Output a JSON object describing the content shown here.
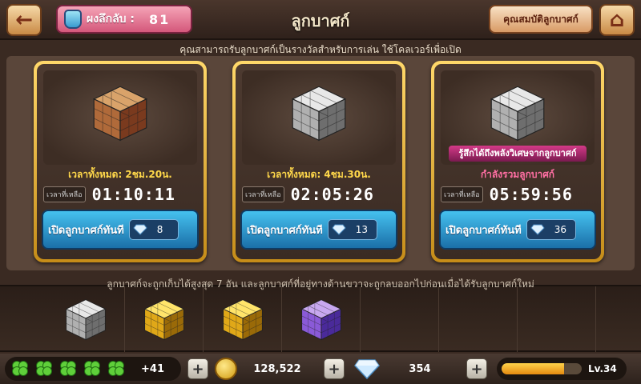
{
  "header": {
    "points_label": "ผงลึกลับ :",
    "points_value": "81",
    "title": "ลูกบาศก์",
    "properties_button": "คุณสมบัติลูกบาศก์"
  },
  "info_text": "คุณสามารถรับลูกบาศก์เป็นรางวัลสำหรับการเล่น ใช้โคลเวอร์เพื่อเปิด",
  "cards": [
    {
      "cube_color": "wood",
      "subtitle": "เวลาทั้งหมด: 2ชม.20น.",
      "timer_tag": "เวลาที่เหลือ",
      "timer": "01:10:11",
      "open_label": "เปิดลูกบาศก์ทันที",
      "cost": "8"
    },
    {
      "cube_color": "silver",
      "subtitle": "เวลาทั้งหมด: 4ชม.30น.",
      "timer_tag": "เวลาที่เหลือ",
      "timer": "02:05:26",
      "open_label": "เปิดลูกบาศก์ทันที",
      "cost": "13"
    },
    {
      "cube_color": "silver",
      "special": "รู้สึกได้ถึงพลังวิเศษจากลูกบาศก์",
      "subtitle": "กำลังรวมลูกบาศก์",
      "timer_tag": "เวลาที่เหลือ",
      "timer": "05:59:56",
      "open_label": "เปิดลูกบาศก์ทันที",
      "cost": "36"
    }
  ],
  "tray_note": "ลูกบาศก์จะถูกเก็บได้สูงสุด 7 อัน และลูกบาศก์ที่อยู่ทางด้านขวาจะถูกลบออกไปก่อนเมื่อได้รับลูกบาศก์ใหม่",
  "tray_cubes": [
    "silver",
    "gold",
    "gold",
    "crystal",
    "",
    "",
    ""
  ],
  "status": {
    "clover_count": 5,
    "clover_extra": "+41",
    "coins": "128,522",
    "gems": "354",
    "level": "Lv.34",
    "xp_fraction": 0.78
  },
  "colors": {
    "wood": [
      "#d9a36a",
      "#b06a3a",
      "#7a3a1e"
    ],
    "silver": [
      "#e8e8e8",
      "#b0b0b0",
      "#6e6e6e"
    ],
    "gold": [
      "#ffe46a",
      "#e0a818",
      "#9a6a08"
    ],
    "crystal": [
      "#c8a8f0",
      "#8a5ad8",
      "#4a2a9a"
    ]
  }
}
